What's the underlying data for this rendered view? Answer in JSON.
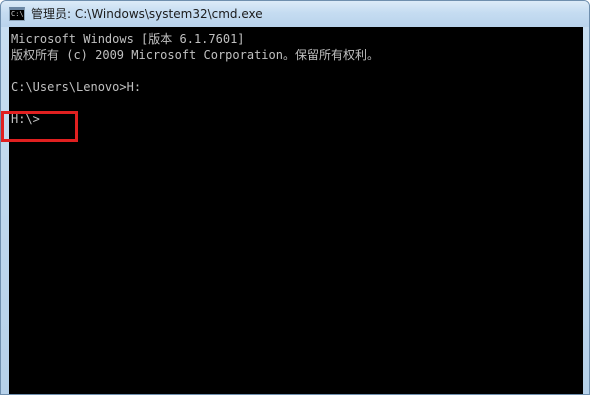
{
  "window": {
    "title": "管理员: C:\\Windows\\system32\\cmd.exe",
    "icon": "cmd-icon"
  },
  "console": {
    "lines": [
      "Microsoft Windows [版本 6.1.7601]",
      "版权所有 (c) 2009 Microsoft Corporation。保留所有权利。",
      "",
      "C:\\Users\\Lenovo>H:",
      "",
      "H:\\>"
    ]
  },
  "highlight": {
    "color": "#e02020",
    "target": "current-prompt"
  },
  "colors": {
    "console_bg": "#000000",
    "console_text": "#c0c0c0"
  }
}
